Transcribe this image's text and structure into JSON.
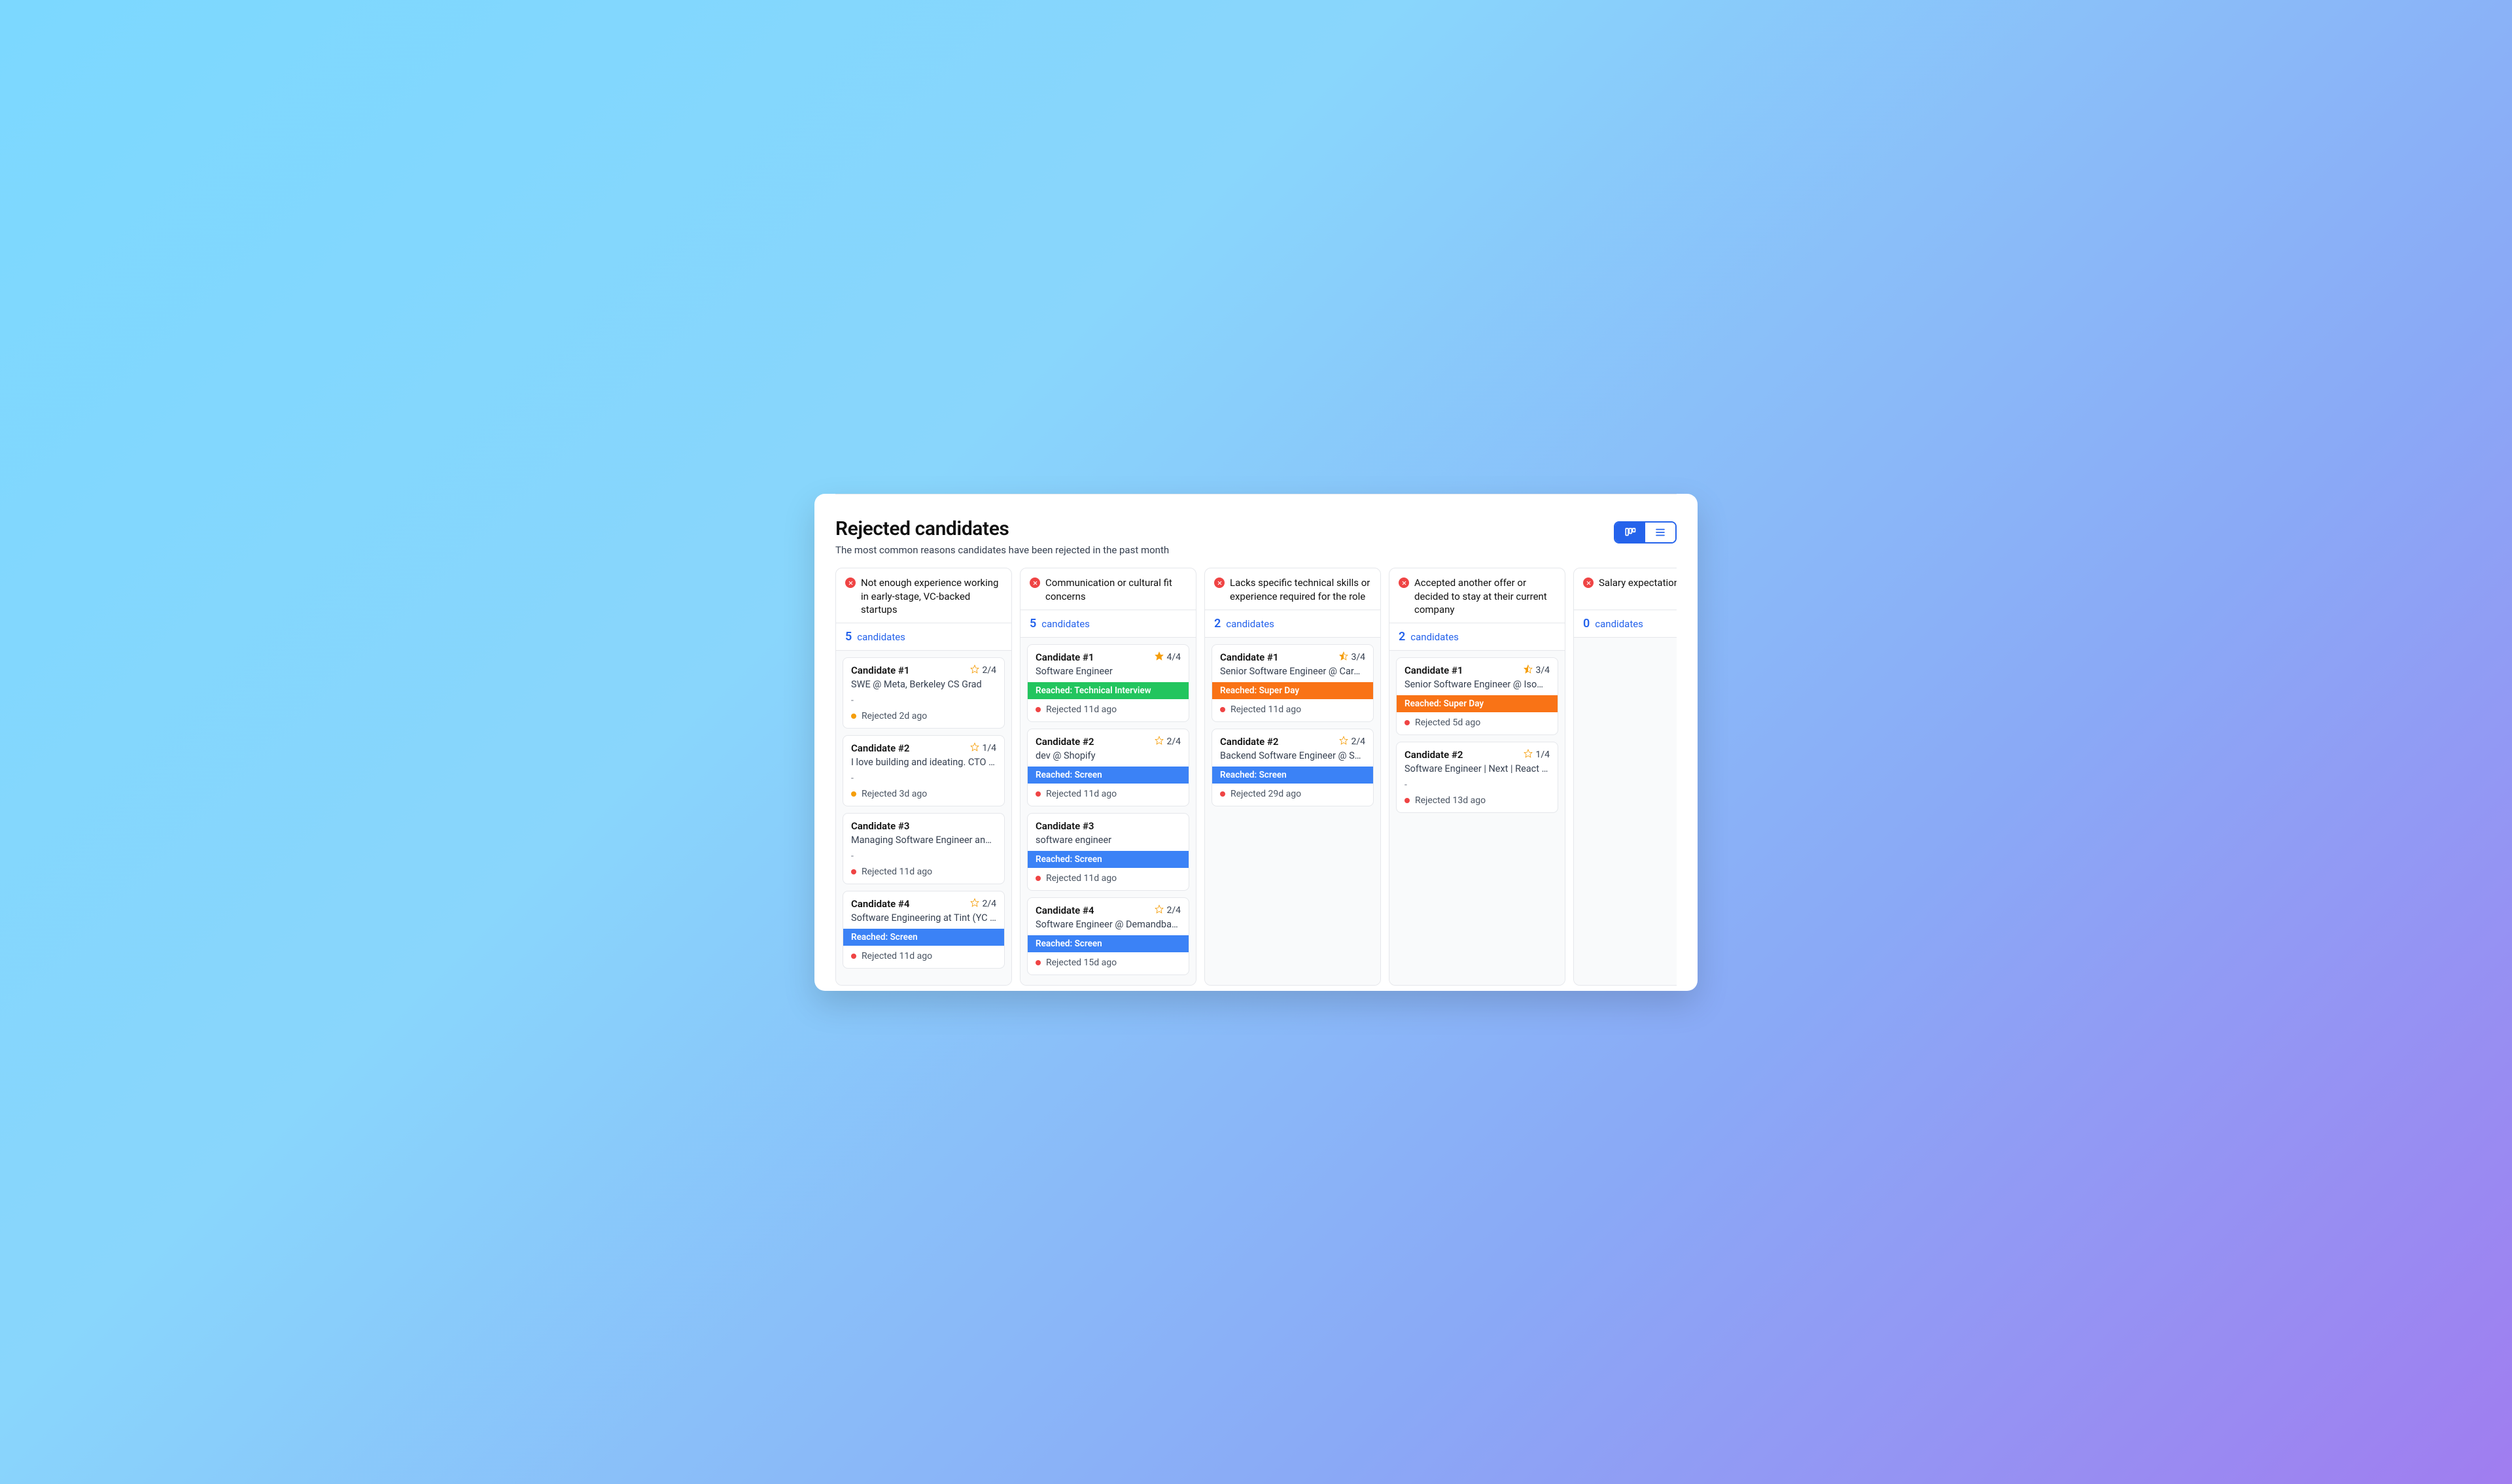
{
  "header": {
    "title": "Rejected candidates",
    "subtitle": "The most common reasons candidates have been rejected in the past month"
  },
  "count_label": "candidates",
  "columns": [
    {
      "title": "Not enough experience working in early-stage, VC-backed startups",
      "count": "5",
      "cards": [
        {
          "name": "Candidate #1",
          "rating": "2/4",
          "star": "outline",
          "desc": "SWE @ Meta, Berkeley CS Grad",
          "stage": "-",
          "stage_color": "",
          "status_dot": "amber",
          "status": "Rejected 2d ago"
        },
        {
          "name": "Candidate #2",
          "rating": "1/4",
          "star": "outline",
          "desc": "I love building and ideating. CTO at …",
          "stage": "-",
          "stage_color": "",
          "status_dot": "amber",
          "status": "Rejected 3d ago"
        },
        {
          "name": "Candidate #3",
          "rating": "",
          "star": "",
          "desc": "Managing Software Engineer and D…",
          "stage": "-",
          "stage_color": "",
          "status_dot": "red",
          "status": "Rejected 11d ago"
        },
        {
          "name": "Candidate #4",
          "rating": "2/4",
          "star": "outline",
          "desc": "Software Engineering at Tint (YC W…",
          "stage": "Reached: Screen",
          "stage_color": "blue",
          "status_dot": "red",
          "status": "Rejected 11d ago"
        }
      ]
    },
    {
      "title": "Communication or cultural fit concerns",
      "count": "5",
      "cards": [
        {
          "name": "Candidate #1",
          "rating": "4/4",
          "star": "full",
          "desc": "Software Engineer",
          "stage": "Reached: Technical Interview",
          "stage_color": "green",
          "status_dot": "red",
          "status": "Rejected 11d ago"
        },
        {
          "name": "Candidate #2",
          "rating": "2/4",
          "star": "outline",
          "desc": "dev @ Shopify",
          "stage": "Reached: Screen",
          "stage_color": "blue",
          "status_dot": "red",
          "status": "Rejected 11d ago"
        },
        {
          "name": "Candidate #3",
          "rating": "",
          "star": "",
          "desc": "software engineer",
          "stage": "Reached: Screen",
          "stage_color": "blue",
          "status_dot": "red",
          "status": "Rejected 11d ago"
        },
        {
          "name": "Candidate #4",
          "rating": "2/4",
          "star": "outline",
          "desc": "Software Engineer @ Demandbase",
          "stage": "Reached: Screen",
          "stage_color": "blue",
          "status_dot": "red",
          "status": "Rejected 15d ago"
        }
      ]
    },
    {
      "title": "Lacks specific technical skills or experience required for the role",
      "count": "2",
      "cards": [
        {
          "name": "Candidate #1",
          "rating": "3/4",
          "star": "half",
          "desc": "Senior Software Engineer @ Caraway",
          "stage": "Reached: Super Day",
          "stage_color": "orange",
          "status_dot": "red",
          "status": "Rejected 11d ago"
        },
        {
          "name": "Candidate #2",
          "rating": "2/4",
          "star": "outline",
          "desc": "Backend Software Engineer @ Sho…",
          "stage": "Reached: Screen",
          "stage_color": "blue",
          "status_dot": "red",
          "status": "Rejected 29d ago"
        }
      ]
    },
    {
      "title": "Accepted another offer or decided to stay at their current company",
      "count": "2",
      "cards": [
        {
          "name": "Candidate #1",
          "rating": "3/4",
          "star": "half",
          "desc": "Senior Software Engineer @ Isomet…",
          "stage": "Reached: Super Day",
          "stage_color": "orange",
          "status_dot": "red",
          "status": "Rejected 5d ago"
        },
        {
          "name": "Candidate #2",
          "rating": "1/4",
          "star": "outline",
          "desc": "Software Engineer | Next | React | A…",
          "stage": "-",
          "stage_color": "",
          "status_dot": "red",
          "status": "Rejected 13d ago"
        }
      ]
    },
    {
      "title": "Salary expectations",
      "count": "0",
      "cards": []
    }
  ]
}
